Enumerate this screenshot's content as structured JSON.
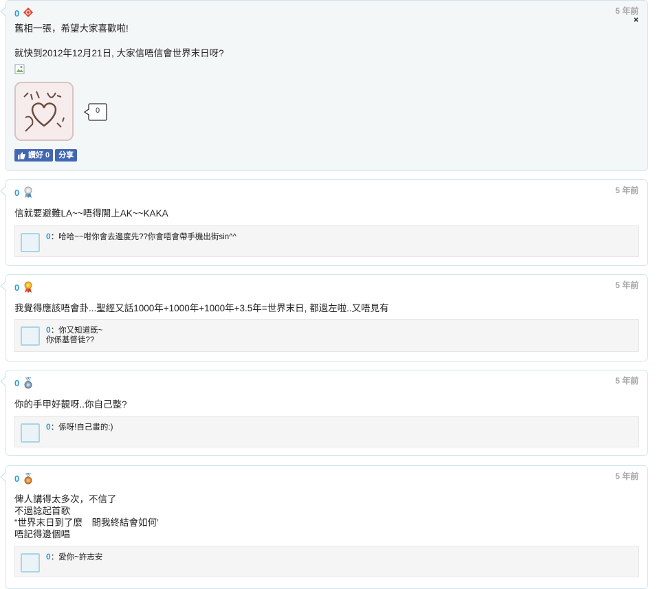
{
  "posts": [
    {
      "score": "0",
      "medal": "flower-badge-icon",
      "time": "5 年前",
      "close": "×",
      "lines": [
        "舊相一張，希望大家喜歡啦!",
        "",
        "就快到2012年12月21日, 大家信唔信會世界末日呀?"
      ],
      "sticker_text": "派心",
      "comment_count": "0",
      "like_label": "讚好 0",
      "share_label": "分享"
    },
    {
      "score": "0",
      "medal": "silver-ribbon-icon",
      "time": "5 年前",
      "text": "信就要避難LA~~唔得開上AK~~KAKA",
      "reply": {
        "score": "0",
        "text": "：哈哈~~咁你會去邊度先??你會唔會帶手機出街sin^^"
      }
    },
    {
      "score": "0",
      "medal": "gold-ribbon-icon",
      "time": "5 年前",
      "text": "我覺得應該唔會卦...聖經又話1000年+1000年+1000年+3.5年=世界末日, 都過左啦..又唔見有",
      "reply": {
        "score": "0",
        "text": "：你又知道既~",
        "text2": "你係基督徒??"
      }
    },
    {
      "score": "0",
      "medal": "blue-medal-icon",
      "time": "5 年前",
      "text": "你的手甲好靚呀..你自己整?",
      "reply": {
        "score": "0",
        "text": "：係呀!自己畫的:)"
      }
    },
    {
      "score": "0",
      "medal": "bronze-medal-icon",
      "time": "5 年前",
      "lines": [
        "俾人講得太多次，不信了",
        "不過諗起首歌",
        "“世界末日到了麼　問我終結會如何’",
        "唔記得邊個唱"
      ],
      "reply": {
        "score": "0",
        "text": "：愛你~許志安"
      }
    }
  ],
  "colors": {
    "accent": "#2e9bd6",
    "facebook": "#4267b2",
    "border": "#cfe6ec"
  }
}
